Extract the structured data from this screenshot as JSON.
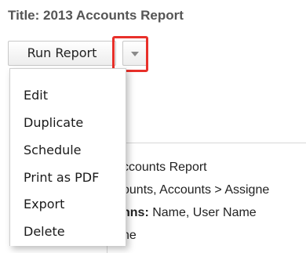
{
  "title": "Title: 2013 Accounts Report",
  "toolbar": {
    "run_label": "Run Report",
    "dropdown_icon": "caret-down-icon",
    "highlight_color": "#e8302a"
  },
  "menu": {
    "items": [
      "Edit",
      "Duplicate",
      "Schedule",
      "Print as PDF",
      "Export",
      "Delete"
    ]
  },
  "background": {
    "line1": "ccounts Report",
    "line2": "ounts, Accounts > Assigne",
    "line3_bold": "nns:",
    "line3_rest": " Name, User Name",
    "line4": "ne"
  }
}
